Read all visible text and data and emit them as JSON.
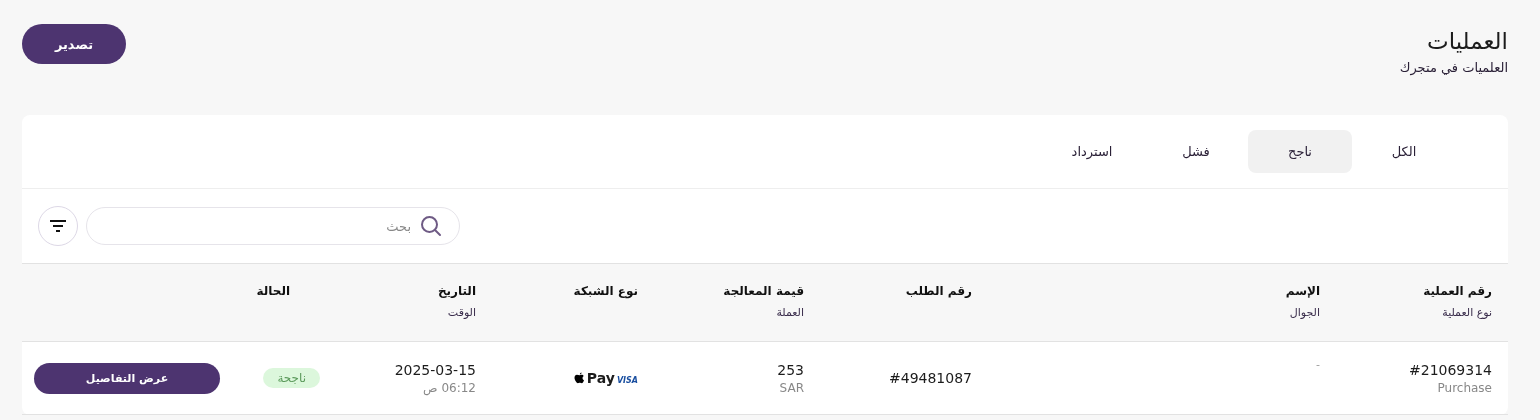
{
  "header": {
    "title": "العمليات",
    "subtitle": "العلميات في متجرك",
    "export_button": "تصدير"
  },
  "tabs": [
    {
      "label": "الكل",
      "selected": false
    },
    {
      "label": "ناجح",
      "selected": true
    },
    {
      "label": "فشل",
      "selected": false
    },
    {
      "label": "استرداد",
      "selected": false
    }
  ],
  "search": {
    "placeholder": "بحث"
  },
  "table": {
    "columns": [
      {
        "title": "رقم العملية",
        "subtitle": "نوع العملية"
      },
      {
        "title": "الإسم",
        "subtitle": "الجوال"
      },
      {
        "title": "رقم الطلب"
      },
      {
        "title": "قيمة المعالجة",
        "subtitle": "العملة"
      },
      {
        "title": "نوع الشبكة"
      },
      {
        "title": "التاريخ",
        "subtitle": "الوقت"
      },
      {
        "title": "الحالة"
      }
    ],
    "rows": [
      {
        "transaction_id": "#21069314",
        "transaction_type": "Purchase",
        "name": "-",
        "order_id": "#49481087",
        "amount": "253",
        "currency": "SAR",
        "network": {
          "wallet": "Pay",
          "card": "VISA"
        },
        "date": "2025-03-15",
        "time": "06:12 ص",
        "status": {
          "label": "ناجحة",
          "kind": "success"
        },
        "action": "عرض التفاصيل"
      }
    ]
  }
}
